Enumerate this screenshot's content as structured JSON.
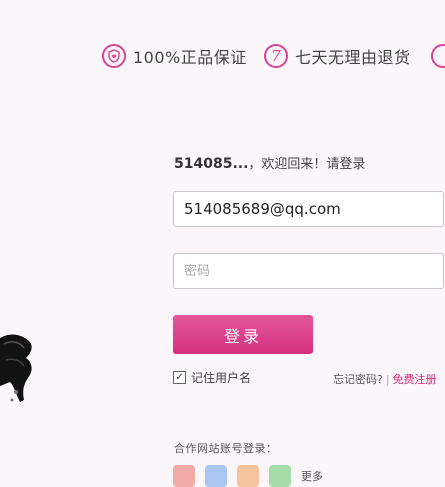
{
  "promos": [
    {
      "icon": "shield-heart-icon",
      "text": "100%正品保证"
    },
    {
      "icon": "seven-days-icon",
      "glyph": "7",
      "text": "七天无理由退货"
    },
    {
      "icon": "partial-promo-icon",
      "text": ""
    }
  ],
  "welcome": {
    "user": "514085...",
    "message": "，欢迎回来！请登录"
  },
  "form": {
    "username_value": "514085689@qq.com",
    "password_placeholder": "密码",
    "login_label": "登录",
    "remember_label": "记住用户名",
    "remember_checked": true,
    "checkmark": "✓",
    "forgot_label": "忘记密码?",
    "separator": "|",
    "register_label": "免费注册"
  },
  "partner": {
    "label": "合作网站账号登录：",
    "providers": [
      "weibo-icon",
      "qq-icon",
      "alipay-icon",
      "wechat-icon"
    ],
    "more_label": "更多"
  },
  "colors": {
    "accent": "#d42f80",
    "background": "#fbf6fa"
  }
}
